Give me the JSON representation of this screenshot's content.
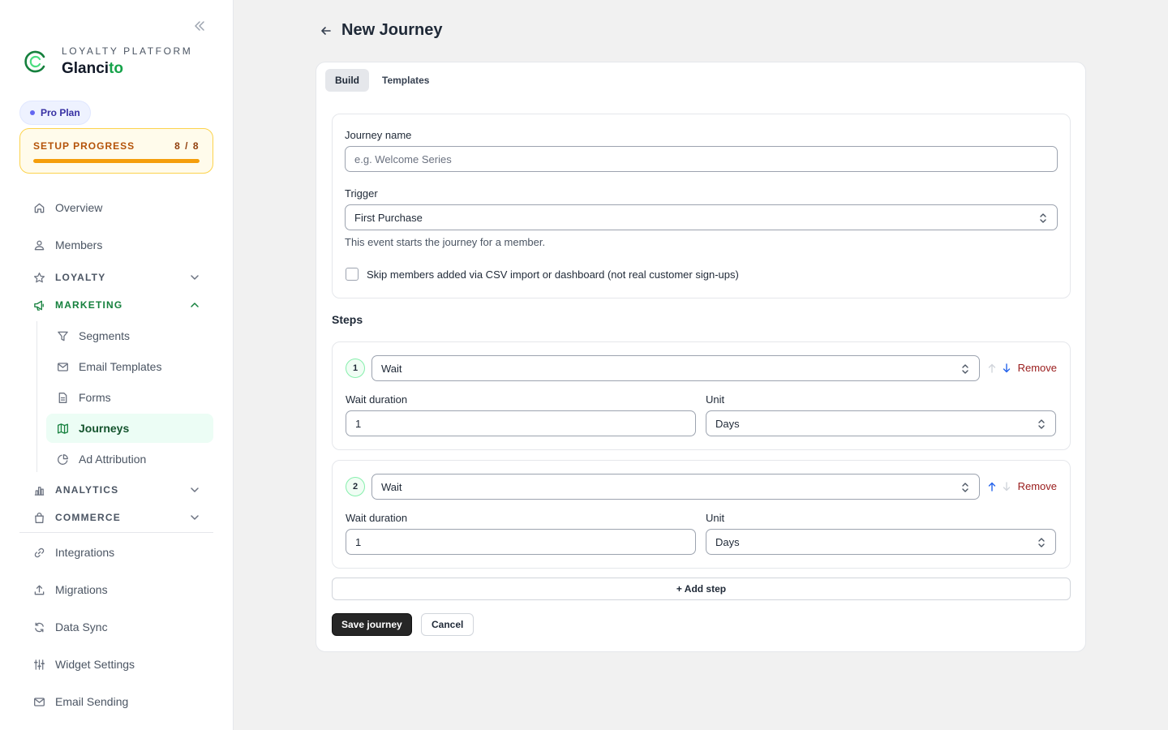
{
  "sidebar": {
    "brand_sub": "LOYALTY PLATFORM",
    "brand_name_main": "Glanci",
    "brand_name_accent": "to",
    "plan": "Pro Plan",
    "setup": {
      "label": "SETUP PROGRESS",
      "count": "8 / 8",
      "progress": 1.0
    },
    "items": [
      {
        "label": "Overview",
        "icon": "home-icon"
      },
      {
        "label": "Members",
        "icon": "members-icon"
      }
    ],
    "sections": {
      "loyalty": "LOYALTY",
      "marketing": "MARKETING",
      "analytics": "ANALYTICS",
      "commerce": "COMMERCE"
    },
    "marketing_items": [
      {
        "label": "Segments",
        "icon": "filter-icon"
      },
      {
        "label": "Email Templates",
        "icon": "mail-icon"
      },
      {
        "label": "Forms",
        "icon": "document-icon"
      },
      {
        "label": "Journeys",
        "icon": "map-icon",
        "active": true
      },
      {
        "label": "Ad Attribution",
        "icon": "pie-chart-icon"
      }
    ],
    "bottom_items": [
      {
        "label": "Integrations",
        "icon": "link-icon"
      },
      {
        "label": "Migrations",
        "icon": "upload-icon"
      },
      {
        "label": "Data Sync",
        "icon": "refresh-icon"
      },
      {
        "label": "Widget Settings",
        "icon": "sliders-icon"
      },
      {
        "label": "Email Sending",
        "icon": "mail-icon"
      }
    ]
  },
  "header": {
    "title": "New Journey"
  },
  "tabs": [
    "Build",
    "Templates"
  ],
  "form": {
    "journey_name_label": "Journey name",
    "journey_name_placeholder": "e.g. Welcome Series",
    "journey_name_value": "",
    "trigger_label": "Trigger",
    "trigger_value": "First Purchase",
    "trigger_help": "This event starts the journey for a member.",
    "skip_label": "Skip members added via CSV import or dashboard (not real customer sign-ups)",
    "skip_checked": false
  },
  "steps_title": "Steps",
  "steps": [
    {
      "number": "1",
      "type": "Wait",
      "duration_label": "Wait duration",
      "duration": "1",
      "unit_label": "Unit",
      "unit": "Days",
      "remove": "Remove"
    },
    {
      "number": "2",
      "type": "Wait",
      "duration_label": "Wait duration",
      "duration": "1",
      "unit_label": "Unit",
      "unit": "Days",
      "remove": "Remove"
    }
  ],
  "add_step": "+ Add step",
  "actions": {
    "save": "Save journey",
    "cancel": "Cancel"
  },
  "colors": {
    "accent": "#16a34a",
    "active_bg": "#ecfdf5",
    "warning": "#f59e0b",
    "danger": "#991b1b",
    "link_blue": "#2563eb"
  }
}
